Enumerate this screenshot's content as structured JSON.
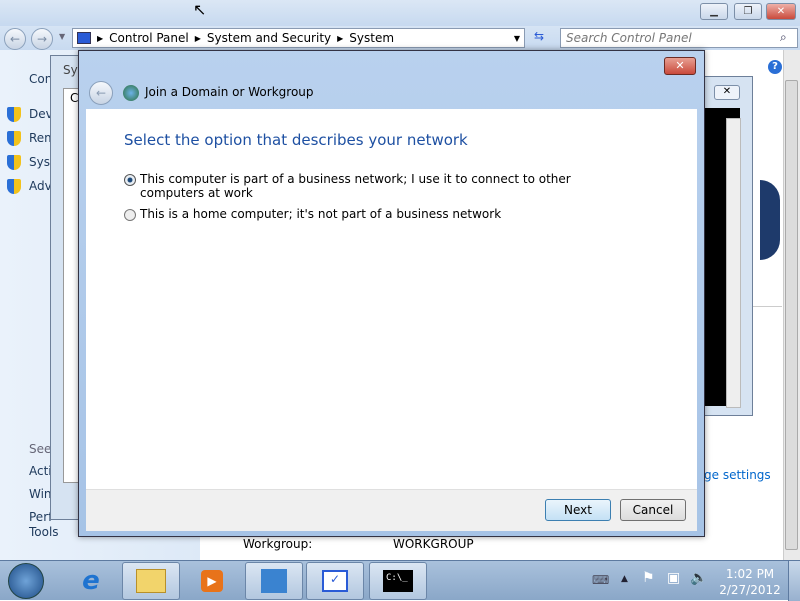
{
  "explorer": {
    "breadcrumb": [
      "Control Panel",
      "System and Security",
      "System"
    ],
    "search_placeholder": "Search Control Panel",
    "left_items": [
      "Con",
      "Dev",
      "Rem",
      "Syst",
      "Adv"
    ],
    "see_also": "See",
    "see_also_items": [
      "Acti",
      "Win",
      "Perf",
      "Tools"
    ],
    "change_settings": "ge settings",
    "workgroup_label": "Workgroup:",
    "workgroup_value": "WORKGROUP",
    "behind_title": "Sys",
    "behind_text": "C"
  },
  "dialog": {
    "title": "Join a Domain or Workgroup",
    "heading": "Select the option that describes your network",
    "options": [
      {
        "label": "This computer is part of a business network; I use it to connect to other computers at work",
        "selected": true
      },
      {
        "label": "This is a home computer; it's not part of a business network",
        "selected": false
      }
    ],
    "next": "Next",
    "cancel": "Cancel",
    "close": "✕"
  },
  "taskbar": {
    "time": "1:02 PM",
    "date": "2/27/2012",
    "apps": [
      "internet-explorer",
      "windows-explorer",
      "media-player",
      "control-panel",
      "system-properties",
      "command-prompt"
    ]
  },
  "colors": {
    "heading": "#1e50a2",
    "link": "#0066cc",
    "close": "#c94a3c"
  }
}
